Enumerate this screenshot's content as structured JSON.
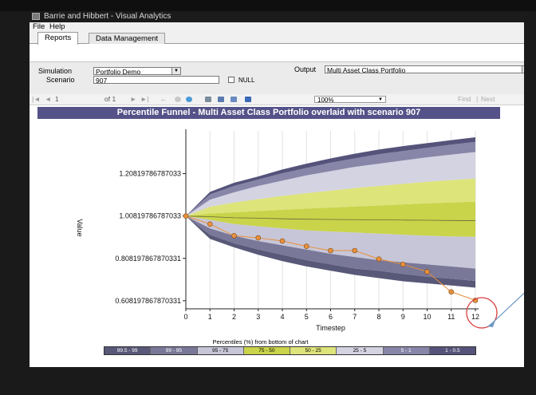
{
  "window": {
    "title": "Barrie and Hibbert - Visual Analytics"
  },
  "menu": {
    "items": [
      "File",
      "Help"
    ]
  },
  "tabs": [
    {
      "label": "Reports"
    },
    {
      "label": "Data Management"
    }
  ],
  "params": {
    "simulation_label": "Simulation",
    "simulation_value": "Portfolio Demo",
    "scenario_label": "Scenario",
    "scenario_value": "907",
    "null_label": "NULL",
    "output_label": "Output",
    "output_value": "Multi Asset Class Portfolio"
  },
  "toolbar": {
    "page": "1",
    "of_pages": "of 1",
    "zoom": "100%",
    "find": "Find",
    "next": "Next"
  },
  "report": {
    "banner": "Percentile Funnel - Multi Asset Class Portfolio overlaid with scenario 907"
  },
  "chart_data": {
    "type": "area",
    "title": "Percentile Funnel - Multi Asset Class Portfolio overlaid with scenario 907",
    "xlabel": "Timestep",
    "ylabel": "Value",
    "x": [
      0,
      1,
      2,
      3,
      4,
      5,
      6,
      7,
      8,
      9,
      10,
      11,
      12
    ],
    "xlim": [
      0,
      12
    ],
    "ylim": [
      0.57,
      1.41
    ],
    "yticks": [
      {
        "value": 0.608197867870331,
        "label": "0.608197867870331"
      },
      {
        "value": 0.808197867870331,
        "label": "0.808197867870331"
      },
      {
        "value": 1.00819786787033,
        "label": "1.00819786787033"
      },
      {
        "value": 1.20819786787033,
        "label": "1.20819786787033"
      }
    ],
    "grid": true,
    "bands": [
      {
        "name": "99.5 - 99",
        "color": "#585878",
        "lower": [
          1.008,
          0.9,
          0.86,
          0.825,
          0.795,
          0.77,
          0.75,
          0.73,
          0.715,
          0.7,
          0.69,
          0.68,
          0.67
        ],
        "upper": [
          1.008,
          0.92,
          0.88,
          0.85,
          0.825,
          0.8,
          0.78,
          0.76,
          0.75,
          0.735,
          0.722,
          0.712,
          0.702
        ]
      },
      {
        "name": "99 - 95",
        "color": "#7a7898",
        "lower": [
          1.008,
          0.92,
          0.88,
          0.85,
          0.825,
          0.8,
          0.78,
          0.76,
          0.75,
          0.735,
          0.722,
          0.712,
          0.702
        ],
        "upper": [
          1.008,
          0.95,
          0.915,
          0.89,
          0.87,
          0.85,
          0.83,
          0.815,
          0.8,
          0.79,
          0.78,
          0.77,
          0.76
        ]
      },
      {
        "name": "95 - 75",
        "color": "#c7c6d8",
        "lower": [
          1.008,
          0.95,
          0.915,
          0.89,
          0.87,
          0.85,
          0.83,
          0.815,
          0.8,
          0.79,
          0.78,
          0.77,
          0.76
        ],
        "upper": [
          1.008,
          0.99,
          0.97,
          0.96,
          0.95,
          0.94,
          0.935,
          0.93,
          0.925,
          0.92,
          0.915,
          0.912,
          0.91
        ]
      },
      {
        "name": "75 - 50",
        "color": "#c9d44a",
        "lower": [
          1.008,
          0.99,
          0.97,
          0.96,
          0.95,
          0.94,
          0.935,
          0.93,
          0.925,
          0.92,
          0.915,
          0.912,
          0.91
        ],
        "upper": [
          1.008,
          1.02,
          1.026,
          1.032,
          1.038,
          1.043,
          1.048,
          1.053,
          1.058,
          1.063,
          1.068,
          1.072,
          1.076
        ]
      },
      {
        "name": "50 - 25",
        "color": "#dde47a",
        "lower": [
          1.008,
          1.02,
          1.026,
          1.032,
          1.038,
          1.043,
          1.048,
          1.053,
          1.058,
          1.063,
          1.068,
          1.072,
          1.076
        ],
        "upper": [
          1.008,
          1.052,
          1.072,
          1.088,
          1.103,
          1.116,
          1.128,
          1.14,
          1.15,
          1.16,
          1.17,
          1.178,
          1.185
        ]
      },
      {
        "name": "25 - 5",
        "color": "#d4d3e2",
        "lower": [
          1.008,
          1.052,
          1.072,
          1.088,
          1.103,
          1.116,
          1.128,
          1.14,
          1.15,
          1.16,
          1.17,
          1.178,
          1.185
        ],
        "upper": [
          1.008,
          1.085,
          1.12,
          1.15,
          1.175,
          1.2,
          1.22,
          1.24,
          1.255,
          1.27,
          1.285,
          1.298,
          1.31
        ]
      },
      {
        "name": "5 - 1",
        "color": "#8785a8",
        "lower": [
          1.008,
          1.085,
          1.12,
          1.15,
          1.175,
          1.2,
          1.22,
          1.24,
          1.255,
          1.27,
          1.285,
          1.298,
          1.31
        ],
        "upper": [
          1.008,
          1.11,
          1.15,
          1.18,
          1.21,
          1.235,
          1.26,
          1.28,
          1.3,
          1.315,
          1.33,
          1.345,
          1.358
        ]
      },
      {
        "name": "1 - 0.5",
        "color": "#55537a",
        "lower": [
          1.008,
          1.11,
          1.15,
          1.18,
          1.21,
          1.235,
          1.26,
          1.28,
          1.3,
          1.315,
          1.33,
          1.345,
          1.358
        ],
        "upper": [
          1.008,
          1.122,
          1.165,
          1.195,
          1.228,
          1.255,
          1.28,
          1.302,
          1.322,
          1.338,
          1.352,
          1.366,
          1.38
        ]
      }
    ],
    "median": [
      1.008,
      1.005,
      1.0,
      0.998,
      0.995,
      0.993,
      0.992,
      0.991,
      0.99,
      0.989,
      0.988,
      0.987,
      0.986
    ],
    "scenario": {
      "name": "scenario 907",
      "color": "#e8903c",
      "values": [
        1.008,
        0.97,
        0.915,
        0.905,
        0.89,
        0.865,
        0.845,
        0.845,
        0.805,
        0.78,
        0.745,
        0.65,
        0.61
      ]
    },
    "legend": {
      "title": "Percentiles (%) from bottom of chart",
      "position": "bottom",
      "entries": [
        {
          "label": "99.5 - 99",
          "color": "#585878",
          "text_color": "#ffffff"
        },
        {
          "label": "99 - 95",
          "color": "#7a7898",
          "text_color": "#ffffff"
        },
        {
          "label": "95 - 75",
          "color": "#c7c6d8",
          "text_color": "#000000"
        },
        {
          "label": "75 - 50",
          "color": "#c9d44a",
          "text_color": "#000000"
        },
        {
          "label": "50 - 25",
          "color": "#dde47a",
          "text_color": "#000000"
        },
        {
          "label": "25 - 5",
          "color": "#d4d3e2",
          "text_color": "#000000"
        },
        {
          "label": "5 - 1",
          "color": "#8785a8",
          "text_color": "#ffffff"
        },
        {
          "label": "1 - 0.5",
          "color": "#55537a",
          "text_color": "#ffffff"
        }
      ]
    }
  }
}
